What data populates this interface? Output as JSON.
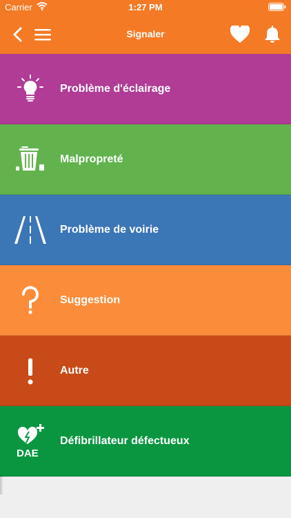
{
  "status_bar": {
    "carrier": "Carrier",
    "time": "1:27 PM"
  },
  "header": {
    "title": "Signaler",
    "color": "#f47a26"
  },
  "menu": {
    "items": [
      {
        "label": "Problème d'éclairage",
        "icon": "light-bulb-icon",
        "color": "#b03c96"
      },
      {
        "label": "Malpropreté",
        "icon": "trash-bin-icon",
        "color": "#62b24d"
      },
      {
        "label": "Problème de voirie",
        "icon": "road-icon",
        "color": "#3b76b6"
      },
      {
        "label": "Suggestion",
        "icon": "question-mark-icon",
        "color": "#fb8c3a"
      },
      {
        "label": "Autre",
        "icon": "exclamation-icon",
        "color": "#c84a18"
      },
      {
        "label": "Défibrillateur défectueux",
        "icon": "defibrillator-icon",
        "icon_text": "DAE",
        "color": "#0a9640"
      }
    ]
  }
}
